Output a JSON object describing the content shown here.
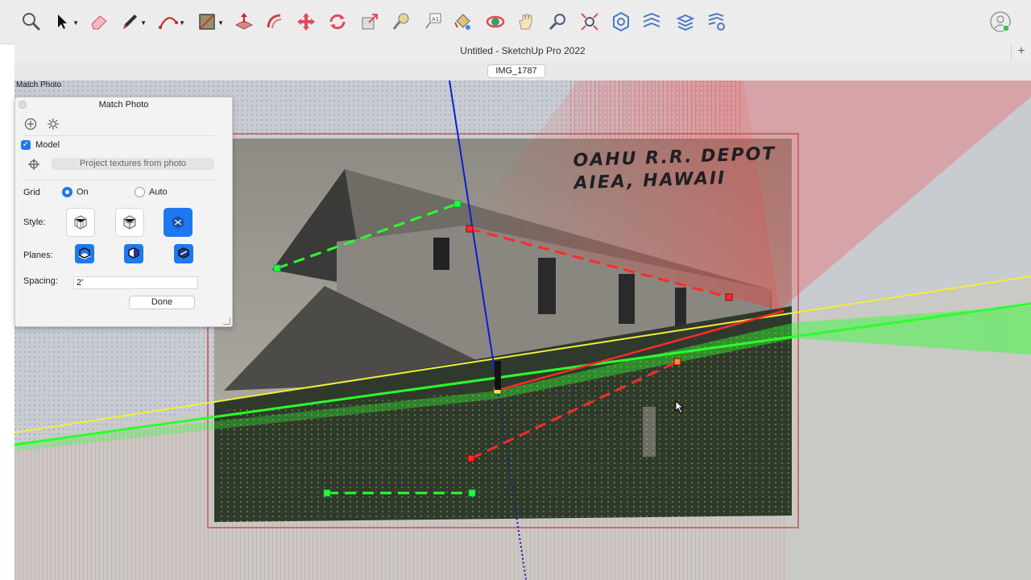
{
  "app": {
    "window_title": "Untitled - SketchUp Pro 2022",
    "scene_tab": "IMG_1787",
    "viewport_caption": "Match Photo"
  },
  "toolbar": {
    "tools": [
      {
        "name": "search",
        "icon": "search-icon"
      },
      {
        "name": "select",
        "icon": "select-arrow-icon"
      },
      {
        "name": "eraser",
        "icon": "eraser-icon"
      },
      {
        "name": "pencil",
        "icon": "pencil-icon"
      },
      {
        "name": "arc",
        "icon": "arc-icon"
      },
      {
        "name": "rectangle",
        "icon": "rectangle-icon"
      },
      {
        "name": "push-pull",
        "icon": "push-pull-icon"
      },
      {
        "name": "offset",
        "icon": "offset-icon"
      },
      {
        "name": "move",
        "icon": "move-icon"
      },
      {
        "name": "rotate",
        "icon": "rotate-icon"
      },
      {
        "name": "scale",
        "icon": "scale-icon"
      },
      {
        "name": "tape-measure",
        "icon": "tape-measure-icon"
      },
      {
        "name": "text",
        "icon": "text-icon"
      },
      {
        "name": "paint-bucket",
        "icon": "paint-bucket-icon"
      },
      {
        "name": "orbit",
        "icon": "orbit-icon"
      },
      {
        "name": "pan",
        "icon": "pan-icon"
      },
      {
        "name": "zoom",
        "icon": "zoom-icon"
      },
      {
        "name": "zoom-extents",
        "icon": "zoom-extents-icon"
      },
      {
        "name": "warehouse",
        "icon": "warehouse-icon"
      },
      {
        "name": "extension-1",
        "icon": "extension-icon"
      },
      {
        "name": "layers",
        "icon": "layers-icon"
      },
      {
        "name": "extension-2",
        "icon": "extension-settings-icon"
      }
    ],
    "account_icon": "account-icon"
  },
  "panel": {
    "title": "Match Photo",
    "model_label": "Model",
    "model_checked": true,
    "project_button": "Project textures from photo",
    "grid_label": "Grid",
    "grid_on": "On",
    "grid_auto": "Auto",
    "grid_selected": "On",
    "style_label": "Style:",
    "planes_label": "Planes:",
    "spacing_label": "Spacing:",
    "spacing_value": "2'",
    "done_button": "Done"
  },
  "photo": {
    "title_line1": "OAHU R.R. DEPOT",
    "title_line2": "AIEA, HAWAII"
  },
  "colors": {
    "red_axis": "#ff2a2a",
    "green_axis": "#2bff2b",
    "blue_axis": "#0a1fd0",
    "horizon": "#f4f04a",
    "accent": "#1e78f0"
  }
}
